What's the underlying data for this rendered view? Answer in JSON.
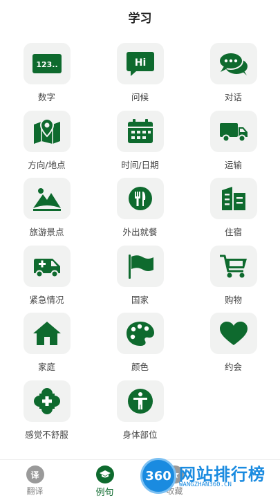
{
  "header": {
    "title": "学习"
  },
  "categories": [
    {
      "label": "数字",
      "icon": "number-123-icon"
    },
    {
      "label": "问候",
      "icon": "hi-bubble-icon"
    },
    {
      "label": "对话",
      "icon": "chat-bubbles-icon"
    },
    {
      "label": "方向/地点",
      "icon": "map-pin-icon"
    },
    {
      "label": "时间/日期",
      "icon": "calendar-icon"
    },
    {
      "label": "运输",
      "icon": "truck-icon"
    },
    {
      "label": "旅游景点",
      "icon": "mountain-icon"
    },
    {
      "label": "外出就餐",
      "icon": "fork-knife-icon"
    },
    {
      "label": "住宿",
      "icon": "buildings-icon"
    },
    {
      "label": "紧急情况",
      "icon": "ambulance-icon"
    },
    {
      "label": "国家",
      "icon": "flag-icon"
    },
    {
      "label": "购物",
      "icon": "shopping-cart-icon"
    },
    {
      "label": "家庭",
      "icon": "house-icon"
    },
    {
      "label": "颜色",
      "icon": "palette-icon"
    },
    {
      "label": "约会",
      "icon": "heart-icon"
    },
    {
      "label": "感觉不舒服",
      "icon": "medical-cross-icon"
    },
    {
      "label": "身体部位",
      "icon": "body-person-icon"
    }
  ],
  "icon_glyphs": {
    "number": "123..",
    "greeting": "Hi"
  },
  "tabs": [
    {
      "label": "翻译",
      "glyph": "译",
      "active": false
    },
    {
      "label": "例句",
      "glyph": "",
      "active": true
    },
    {
      "label": "收藏",
      "glyph": "",
      "active": false
    }
  ],
  "watermark": {
    "badge": "360",
    "text": "网站排行榜",
    "sub": "WANGZHAN360.CN"
  },
  "colors": {
    "accent": "#0e6a2e",
    "tile_bg": "#f1f2f1",
    "inactive": "#9a9a9a"
  }
}
